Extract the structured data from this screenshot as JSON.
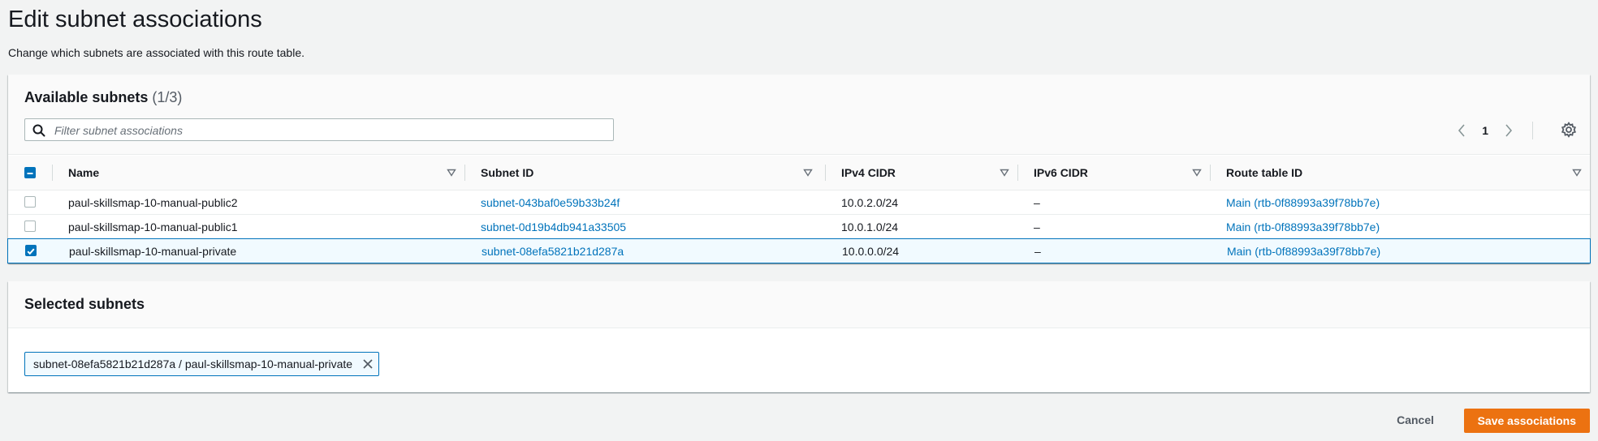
{
  "page": {
    "title": "Edit subnet associations",
    "description": "Change which subnets are associated with this route table."
  },
  "available": {
    "title": "Available subnets",
    "count": "(1/3)",
    "filter_placeholder": "Filter subnet associations",
    "page_number": "1",
    "columns": [
      "Name",
      "Subnet ID",
      "IPv4 CIDR",
      "IPv6 CIDR",
      "Route table ID"
    ],
    "rows": [
      {
        "checked": false,
        "name": "paul-skillsmap-10-manual-public2",
        "subnet_id": "subnet-043baf0e59b33b24f",
        "ipv4": "10.0.2.0/24",
        "ipv6": "–",
        "route_table": "Main (rtb-0f88993a39f78bb7e)"
      },
      {
        "checked": false,
        "name": "paul-skillsmap-10-manual-public1",
        "subnet_id": "subnet-0d19b4db941a33505",
        "ipv4": "10.0.1.0/24",
        "ipv6": "–",
        "route_table": "Main (rtb-0f88993a39f78bb7e)"
      },
      {
        "checked": true,
        "name": "paul-skillsmap-10-manual-private",
        "subnet_id": "subnet-08efa5821b21d287a",
        "ipv4": "10.0.0.0/24",
        "ipv6": "–",
        "route_table": "Main (rtb-0f88993a39f78bb7e)"
      }
    ]
  },
  "selected": {
    "title": "Selected subnets",
    "token": "subnet-08efa5821b21d287a / paul-skillsmap-10-manual-private"
  },
  "footer": {
    "cancel_label": "Cancel",
    "save_label": "Save associations"
  },
  "colors": {
    "accent": "#0073bb",
    "primary_button": "#ec7211"
  }
}
